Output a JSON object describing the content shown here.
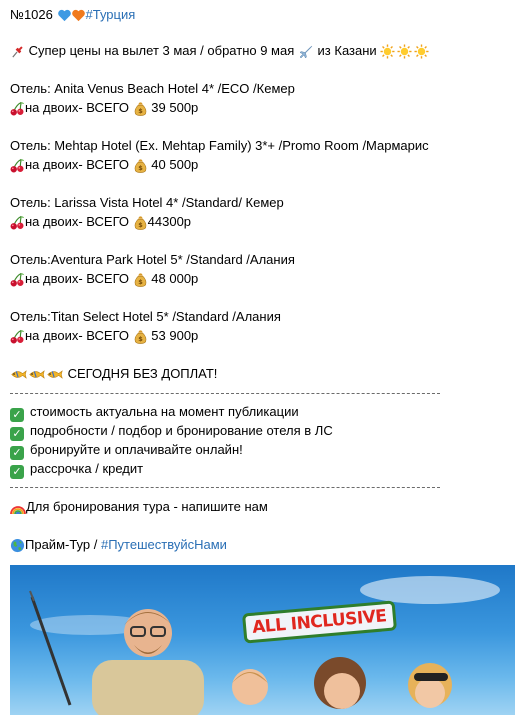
{
  "post": {
    "number": "№1026",
    "hashtag_country": "#Турция",
    "headline": "Супер цены на вылет 3 мая / обратно 9 мая",
    "headline_from": "из Казани",
    "hotels": [
      {
        "hotel": "Отель: Anita Venus Beach Hotel 4* /ECO /Кемер",
        "price_prefix": "на двоих- ВСЕГО",
        "price": "39 500р"
      },
      {
        "hotel": "Отель: Mehtap Hotel (Ex. Mehtap Family) 3*+ /Promo Room /Мармарис",
        "price_prefix": "на двоих- ВСЕГО",
        "price": "40 500р"
      },
      {
        "hotel": "Отель: Larissa Vista Hotel 4* /Standard/ Кемер",
        "price_prefix": "на двоих- ВСЕГО",
        "price": "44300р"
      },
      {
        "hotel": "Отель:Aventura Park Hotel 5* /Standard /Алания",
        "price_prefix": "на двоих- ВСЕГО",
        "price": "48 000р"
      },
      {
        "hotel": "Отель:Titan Select Hotel 5* /Standard /Алания",
        "price_prefix": "на двоих- ВСЕГО",
        "price": "53 900р"
      }
    ],
    "no_surcharge": "СЕГОДНЯ БЕЗ ДОПЛАТ!",
    "checklist": [
      "стоимость актуальна на момент публикации",
      "подробности / подбор и бронирование отеля в ЛС",
      "бронируйте и оплачивайте онлайн!",
      "рассрочка / кредит"
    ],
    "booking_cta": "Для бронирования тура - напишите нам",
    "agency_name": "Прайм-Тур /",
    "agency_hashtag": "#ПутешествуйсНами",
    "image_badge": "ALL INCLUSIVE"
  },
  "icons": {
    "heart_blue": "heart-blue-icon",
    "heart_orange": "heart-orange-icon",
    "pin": "pushpin-icon",
    "plane": "airplane-icon",
    "sun": "sun-icon",
    "cherries": "cherries-icon",
    "money_bag": "money-bag-icon",
    "fish": "tropical-fish-icon",
    "check": "check-mark-icon",
    "rainbow": "rainbow-icon",
    "globe": "globe-icon"
  },
  "colors": {
    "hashtag": "#2a6fb5",
    "check_green": "#3aa34a",
    "badge_red": "#e0271f",
    "badge_green": "#2f7e2c",
    "photo_sky": "#2f88d4"
  }
}
